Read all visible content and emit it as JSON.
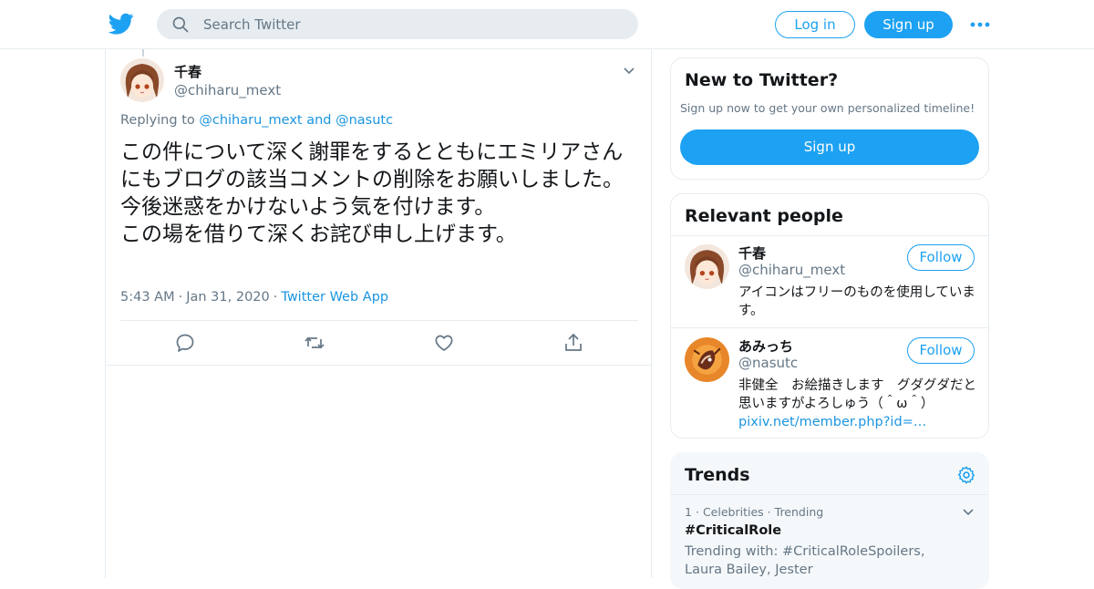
{
  "header": {
    "search_placeholder": "Search Twitter",
    "login_label": "Log in",
    "signup_label": "Sign up",
    "logo_icon": "twitter-bird-icon",
    "more_icon": "more-dots-icon"
  },
  "tweet": {
    "author_name": "千春",
    "author_handle": "@chiharu_mext",
    "replying_prefix": "Replying to",
    "replying_to": "@chiharu_mext and @nasutc",
    "text": "この件について深く謝罪をするとともにエミリアさんにもブログの該当コメントの削除をお願いしました。\n今後迷惑をかけないよう気を付けます。\nこの場を借りて深くお詫び申し上げます。",
    "time": "5:43 AM",
    "date": "Jan 31, 2020",
    "source": "Twitter Web App"
  },
  "sidebar": {
    "new_card": {
      "title": "New to Twitter?",
      "subtitle": "Sign up now to get your own personalized timeline!",
      "button": "Sign up"
    },
    "relevant": {
      "title": "Relevant people",
      "people": [
        {
          "name": "千春",
          "handle": "@chiharu_mext",
          "follow": "Follow",
          "bio": "アイコンはフリーのものを使用しています。",
          "link": ""
        },
        {
          "name": "あみっち",
          "handle": "@nasutc",
          "follow": "Follow",
          "bio": "非健全　お絵描きします　グダグダだと思いますがよろしゅう（＾ω＾）",
          "link": "pixiv.net/member.php?id=…"
        }
      ]
    },
    "trends": {
      "title": "Trends",
      "items": [
        {
          "rank": "1",
          "category": "Celebrities",
          "status": "Trending",
          "name": "#CriticalRole",
          "with": "Trending with: #CriticalRoleSpoilers, Laura Bailey, Jester"
        }
      ]
    }
  },
  "colors": {
    "accent": "#1da1f2",
    "link": "#1b95e0",
    "muted": "#657786",
    "border": "#e6ecf0"
  }
}
